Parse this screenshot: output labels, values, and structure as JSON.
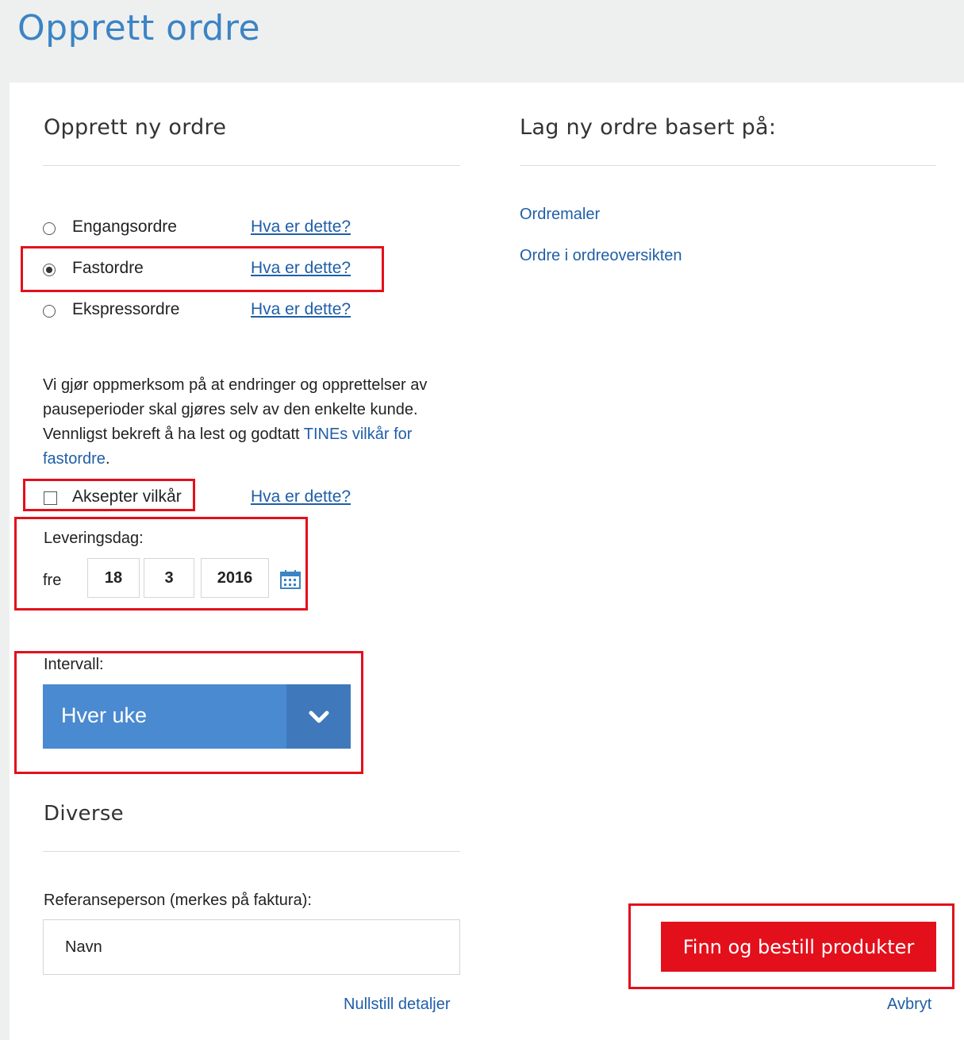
{
  "page": {
    "title": "Opprett ordre"
  },
  "left": {
    "heading": "Opprett ny ordre",
    "order_types": [
      {
        "label": "Engangsordre",
        "checked": false,
        "help": "Hva er dette?"
      },
      {
        "label": "Fastordre",
        "checked": true,
        "help": "Hva er dette?"
      },
      {
        "label": "Ekspressordre",
        "checked": false,
        "help": "Hva er dette?"
      }
    ],
    "notice": {
      "text": "Vi gjør oppmerksom på at endringer og opprettelser av pauseperioder skal gjøres selv av den enkelte kunde. Vennligst bekreft å ha lest og godtatt ",
      "link": "TINEs vilkår for fastordre",
      "end": "."
    },
    "accept": {
      "label": "Aksepter vilkår",
      "checked": false,
      "help": "Hva er dette?"
    },
    "delivery": {
      "label": "Leveringsdag:",
      "weekday": "fre",
      "day": "18",
      "month": "3",
      "year": "2016",
      "icon": "calendar-icon"
    },
    "interval": {
      "label": "Intervall:",
      "selected": "Hver uke",
      "icon": "chevron-down-icon"
    },
    "misc": {
      "heading": "Diverse",
      "reference_label": "Referanseperson (merkes på faktura):",
      "reference_placeholder": "Navn",
      "reset_link": "Nullstill detaljer"
    }
  },
  "right": {
    "heading": "Lag ny ordre basert på:",
    "links": [
      "Ordremaler",
      "Ordre i ordreoversikten"
    ],
    "primary_button": "Finn og bestill produkter",
    "cancel_link": "Avbryt"
  },
  "colors": {
    "accent_blue": "#3b84c5",
    "link_blue": "#1f5ea8",
    "select_blue": "#4a8ad0",
    "highlight_red": "#e3101b",
    "button_red": "#e3101b"
  }
}
